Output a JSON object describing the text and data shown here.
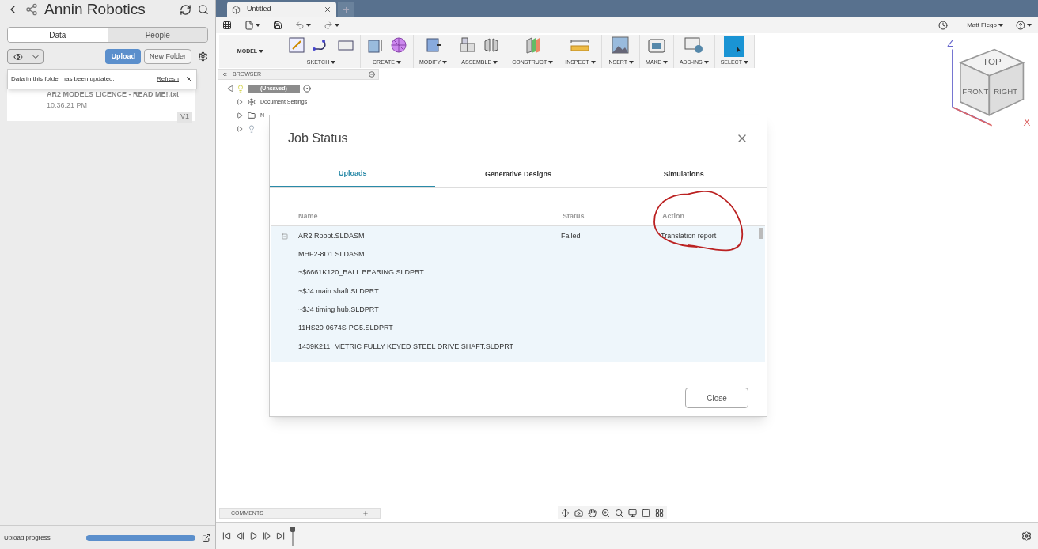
{
  "data_panel": {
    "title": "Annin Robotics",
    "tabs": [
      {
        "label": "Data",
        "selected": true
      },
      {
        "label": "People",
        "selected": false
      }
    ],
    "upload_button": "Upload",
    "new_folder_button": "New Folder",
    "notification": {
      "message": "Data in this folder has been updated.",
      "link": "Refresh"
    },
    "file_card": {
      "name": "AR2 MODELS LICENCE - READ ME!.txt",
      "time": "10:36:21 PM",
      "version": "V1"
    },
    "upload_progress": {
      "label": "Upload progress",
      "level": 1
    }
  },
  "document_tab": {
    "title": "Untitled"
  },
  "user": "Matt Flego",
  "ribbon": {
    "workspace": "MODEL",
    "groups": [
      {
        "label": "SKETCH"
      },
      {
        "label": "CREATE"
      },
      {
        "label": "MODIFY"
      },
      {
        "label": "ASSEMBLE"
      },
      {
        "label": "CONSTRUCT"
      },
      {
        "label": "INSPECT"
      },
      {
        "label": "INSERT"
      },
      {
        "label": "MAKE"
      },
      {
        "label": "ADD-INS"
      },
      {
        "label": "SELECT"
      }
    ]
  },
  "browser": {
    "title": "BROWSER",
    "root": "(Unsaved)",
    "items": [
      {
        "label": "Document Settings",
        "kind": "settings"
      },
      {
        "label": "N",
        "kind": "folder"
      }
    ]
  },
  "view_cube": {
    "faces": [
      "TOP",
      "FRONT",
      "RIGHT"
    ],
    "axes": [
      "Z",
      "X"
    ]
  },
  "job_status": {
    "title": "Job Status",
    "tabs": [
      {
        "label": "Uploads",
        "selected": true
      },
      {
        "label": "Generative Designs",
        "selected": false
      },
      {
        "label": "Simulations",
        "selected": false
      }
    ],
    "columns": [
      "Name",
      "Status",
      "Action"
    ],
    "rows": [
      {
        "name": "AR2 Robot.SLDASM",
        "status": "Failed",
        "action": "Translation report",
        "expandable": true
      },
      {
        "name": "MHF2-8D1.SLDASM"
      },
      {
        "name": "~$6661K120_BALL BEARING.SLDPRT"
      },
      {
        "name": "~$J4 main shaft.SLDPRT"
      },
      {
        "name": "~$J4 timing hub.SLDPRT"
      },
      {
        "name": "11HS20-0674S-PG5.SLDPRT"
      },
      {
        "name": "1439K211_METRIC FULLY KEYED STEEL DRIVE SHAFT.SLDPRT"
      }
    ],
    "close_button": "Close"
  },
  "comments": {
    "title": "COMMENTS"
  }
}
